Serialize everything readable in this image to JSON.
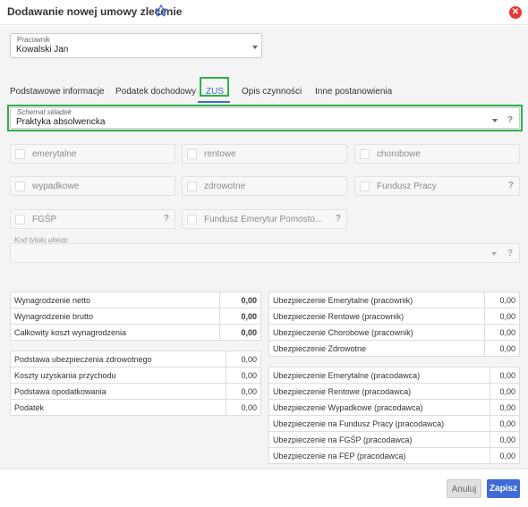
{
  "dialog": {
    "title": "Dodawanie nowej umowy zlecenie"
  },
  "employee": {
    "label": "Pracownik",
    "value": "Kowalski Jan"
  },
  "tabs": [
    {
      "label": "Podstawowe informacje"
    },
    {
      "label": "Podatek dochodowy"
    },
    {
      "label": "ZUS"
    },
    {
      "label": "Opis czynności"
    },
    {
      "label": "Inne postanowienia"
    }
  ],
  "active_tab": "ZUS",
  "schema": {
    "label": "Schemat składek",
    "value": "Praktyka absolwencka",
    "help": "?"
  },
  "checkboxes": [
    {
      "label": "emerytalne",
      "checked": false
    },
    {
      "label": "rentowe",
      "checked": false
    },
    {
      "label": "chorobowe",
      "checked": false
    },
    {
      "label": "wypadkowe",
      "checked": false
    },
    {
      "label": "zdrowotne",
      "checked": false
    },
    {
      "label": "Fundusz Pracy",
      "checked": false,
      "help": "?"
    },
    {
      "label": "FGŚP",
      "checked": false,
      "help": "?"
    },
    {
      "label": "Fundusz Emerytur Pomosto...",
      "checked": false,
      "help": "?"
    }
  ],
  "kod": {
    "label": "Kod tytułu ubezp",
    "value": "",
    "help": "?"
  },
  "left_table_1": [
    {
      "label": "Wynagrodzenie netto",
      "value": "0,00"
    },
    {
      "label": "Wynagrodzenie brutto",
      "value": "0,00"
    },
    {
      "label": "Całkowity koszt wynagrodzenia",
      "value": "0,00"
    }
  ],
  "left_table_2": [
    {
      "label": "Podstawa ubezpieczenia zdrowotnego",
      "value": "0,00"
    },
    {
      "label": "Koszty uzyskania przychodu",
      "value": "0,00"
    },
    {
      "label": "Podstawa opodatkowania",
      "value": "0,00"
    },
    {
      "label": "Podatek",
      "value": "0,00"
    }
  ],
  "right_table_1": [
    {
      "label": "Ubezpieczenie Emerytalne (pracownik)",
      "value": "0,00"
    },
    {
      "label": "Ubezpieczenie Rentowe (pracownik)",
      "value": "0,00"
    },
    {
      "label": "Ubezpieczenie Chorobowe (pracownik)",
      "value": "0,00"
    },
    {
      "label": "Ubezpieczenie Zdrowotne",
      "value": "0,00"
    }
  ],
  "right_table_2": [
    {
      "label": "Ubezpieczenie Emerytalne (pracodawca)",
      "value": "0,00"
    },
    {
      "label": "Ubezpieczenie Rentowe (pracodawca)",
      "value": "0,00"
    },
    {
      "label": "Ubezpieczenie Wypadkowe (pracodawca)",
      "value": "0,00"
    },
    {
      "label": "Ubezpieczenie na Fundusz Pracy (pracodawca)",
      "value": "0,00"
    },
    {
      "label": "Ubezpieczenie na FGŚP (pracodawca)",
      "value": "0,00"
    },
    {
      "label": "Ubezpieczenie na FEP (pracodawca)",
      "value": "0,00"
    }
  ],
  "buttons": {
    "cancel": "Anuluj",
    "save": "Zapisz"
  },
  "colors": {
    "accent": "#3f6ad8",
    "close": "#e53935",
    "highlight": "#2db04a"
  }
}
